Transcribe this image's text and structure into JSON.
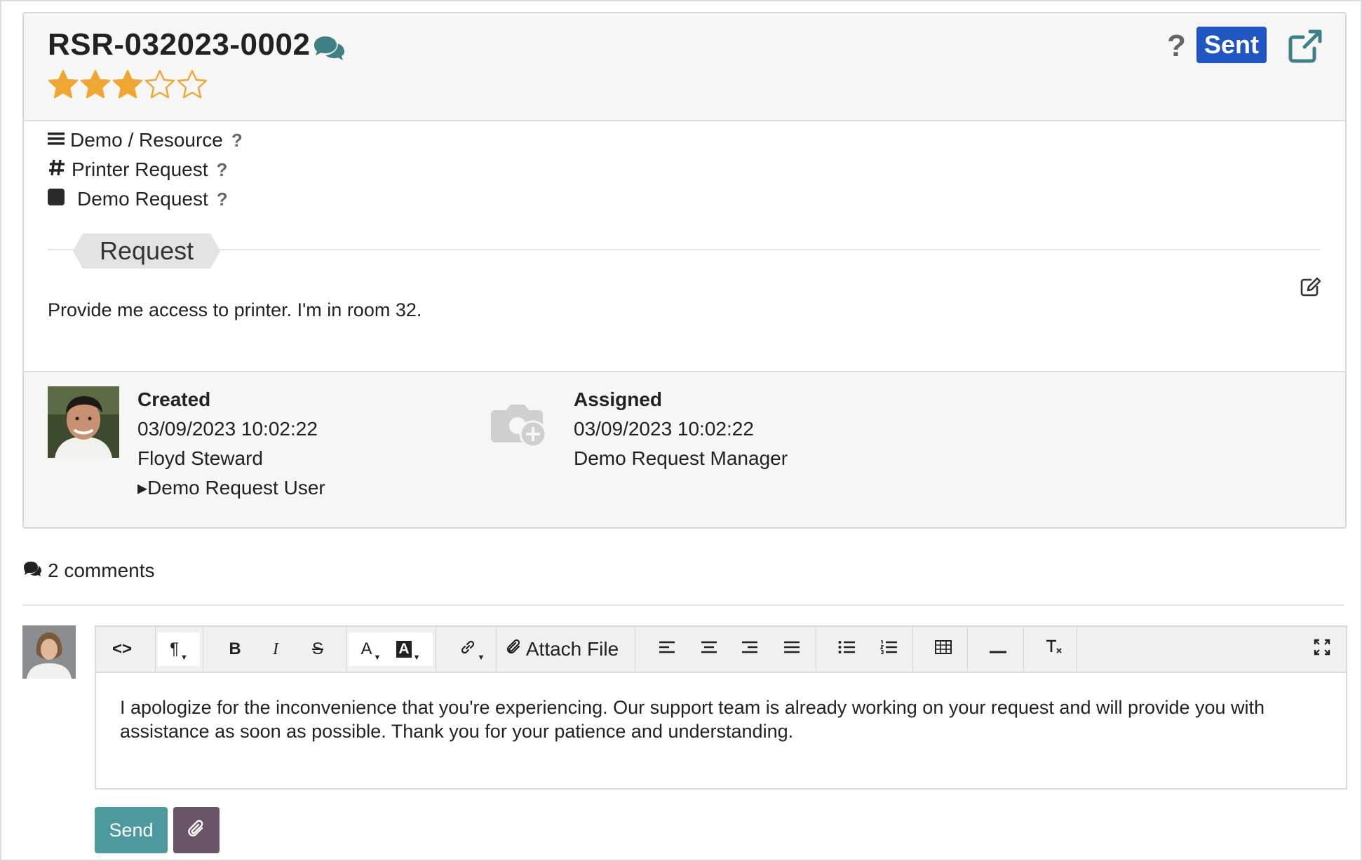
{
  "ticket": {
    "title": "RSR-032023-0002",
    "rating": 3,
    "rating_max": 5,
    "status": "Sent",
    "help_mark": "?"
  },
  "meta": {
    "category": "Demo / Resource",
    "type": "Printer Request",
    "service": "Demo Request",
    "help_mark": "?"
  },
  "request_section": {
    "title": "Request",
    "text": "Provide me access to printer. I'm in room 32."
  },
  "created": {
    "label": "Created",
    "datetime": "03/09/2023 10:02:22",
    "author": "Floyd Steward",
    "role": "Demo Request User",
    "role_marker": "▸"
  },
  "assigned": {
    "label": "Assigned",
    "datetime": "03/09/2023 10:02:22",
    "assignee": "Demo Request Manager"
  },
  "comments": {
    "count_label": "2 comments"
  },
  "editor": {
    "attach_label": "Attach File",
    "text": "I apologize for the inconvenience that you're experiencing. Our support team is already working on your request and will provide you with assistance as soon as possible. Thank you for your patience and understanding.",
    "tools": {
      "code": "<>",
      "paragraph": "¶",
      "bold": "B",
      "italic": "I",
      "strike": "S",
      "font_color": "A",
      "bg_color": "A"
    }
  },
  "actions": {
    "send_label": "Send"
  },
  "colors": {
    "status_badge": "#1f56c2",
    "star": "#f0a732",
    "send_button": "#4c9a9e",
    "attach_button": "#6a5467",
    "chat_icon": "#3f7f86"
  },
  "icons": {
    "title": "comments-icon",
    "external": "external-link-icon",
    "category": "bars-icon",
    "type": "hashtag-icon",
    "service": "square-icon",
    "edit": "edit-icon",
    "assignee_placeholder": "camera-plus-icon",
    "attach": "paperclip-icon",
    "fullscreen": "expand-icon"
  }
}
